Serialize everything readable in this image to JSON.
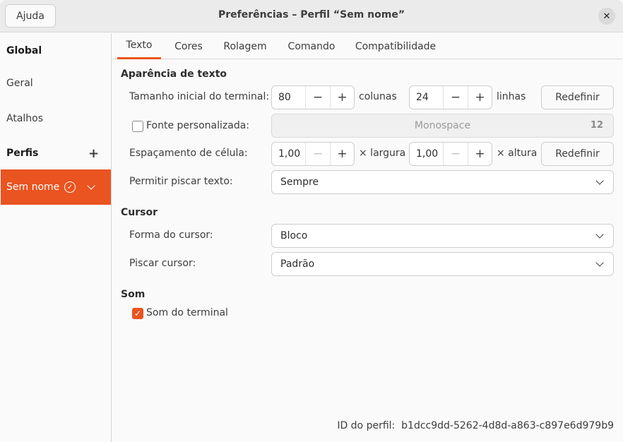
{
  "window": {
    "title": "Preferências – Perfil “Sem nome”",
    "help_label": "Ajuda",
    "close_glyph": "✕"
  },
  "sidebar": {
    "global_header": "Global",
    "items": [
      {
        "label": "Geral"
      },
      {
        "label": "Atalhos"
      }
    ],
    "profiles_header": "Perfis",
    "add_glyph": "+",
    "active_profile": "Sem nome"
  },
  "tabs": [
    {
      "label": "Texto",
      "active": true
    },
    {
      "label": "Cores",
      "active": false
    },
    {
      "label": "Rolagem",
      "active": false
    },
    {
      "label": "Comando",
      "active": false
    },
    {
      "label": "Compatibilidade",
      "active": false
    }
  ],
  "text_appearance": {
    "section_title": "Aparência de texto",
    "terminal_size_label": "Tamanho inicial do terminal:",
    "columns_value": "80",
    "columns_unit": "colunas",
    "rows_value": "24",
    "rows_unit": "linhas",
    "reset_label": "Redefinir",
    "custom_font_label": "Fonte personalizada:",
    "custom_font_checked": false,
    "font_name": "Monospace",
    "font_size": "12",
    "cell_spacing_label": "Espaçamento de célula:",
    "width_value": "1,00",
    "width_unit": "× largura",
    "height_value": "1,00",
    "height_unit": "× altura",
    "blink_label": "Permitir piscar texto:",
    "blink_value": "Sempre"
  },
  "cursor": {
    "section_title": "Cursor",
    "shape_label": "Forma do cursor:",
    "shape_value": "Bloco",
    "blink_label": "Piscar cursor:",
    "blink_value": "Padrão"
  },
  "sound": {
    "section_title": "Som",
    "bell_label": "Som do terminal",
    "bell_checked": true
  },
  "profile_id": {
    "label": "ID do perfil:",
    "value": "b1dcc9dd-5262-4d8d-a863-c897e6d979b9"
  },
  "glyphs": {
    "minus": "−",
    "plus": "+",
    "check": "✓"
  },
  "colors": {
    "accent": "#e95420",
    "titlebar": "#ebebeb",
    "background": "#fafafa"
  }
}
